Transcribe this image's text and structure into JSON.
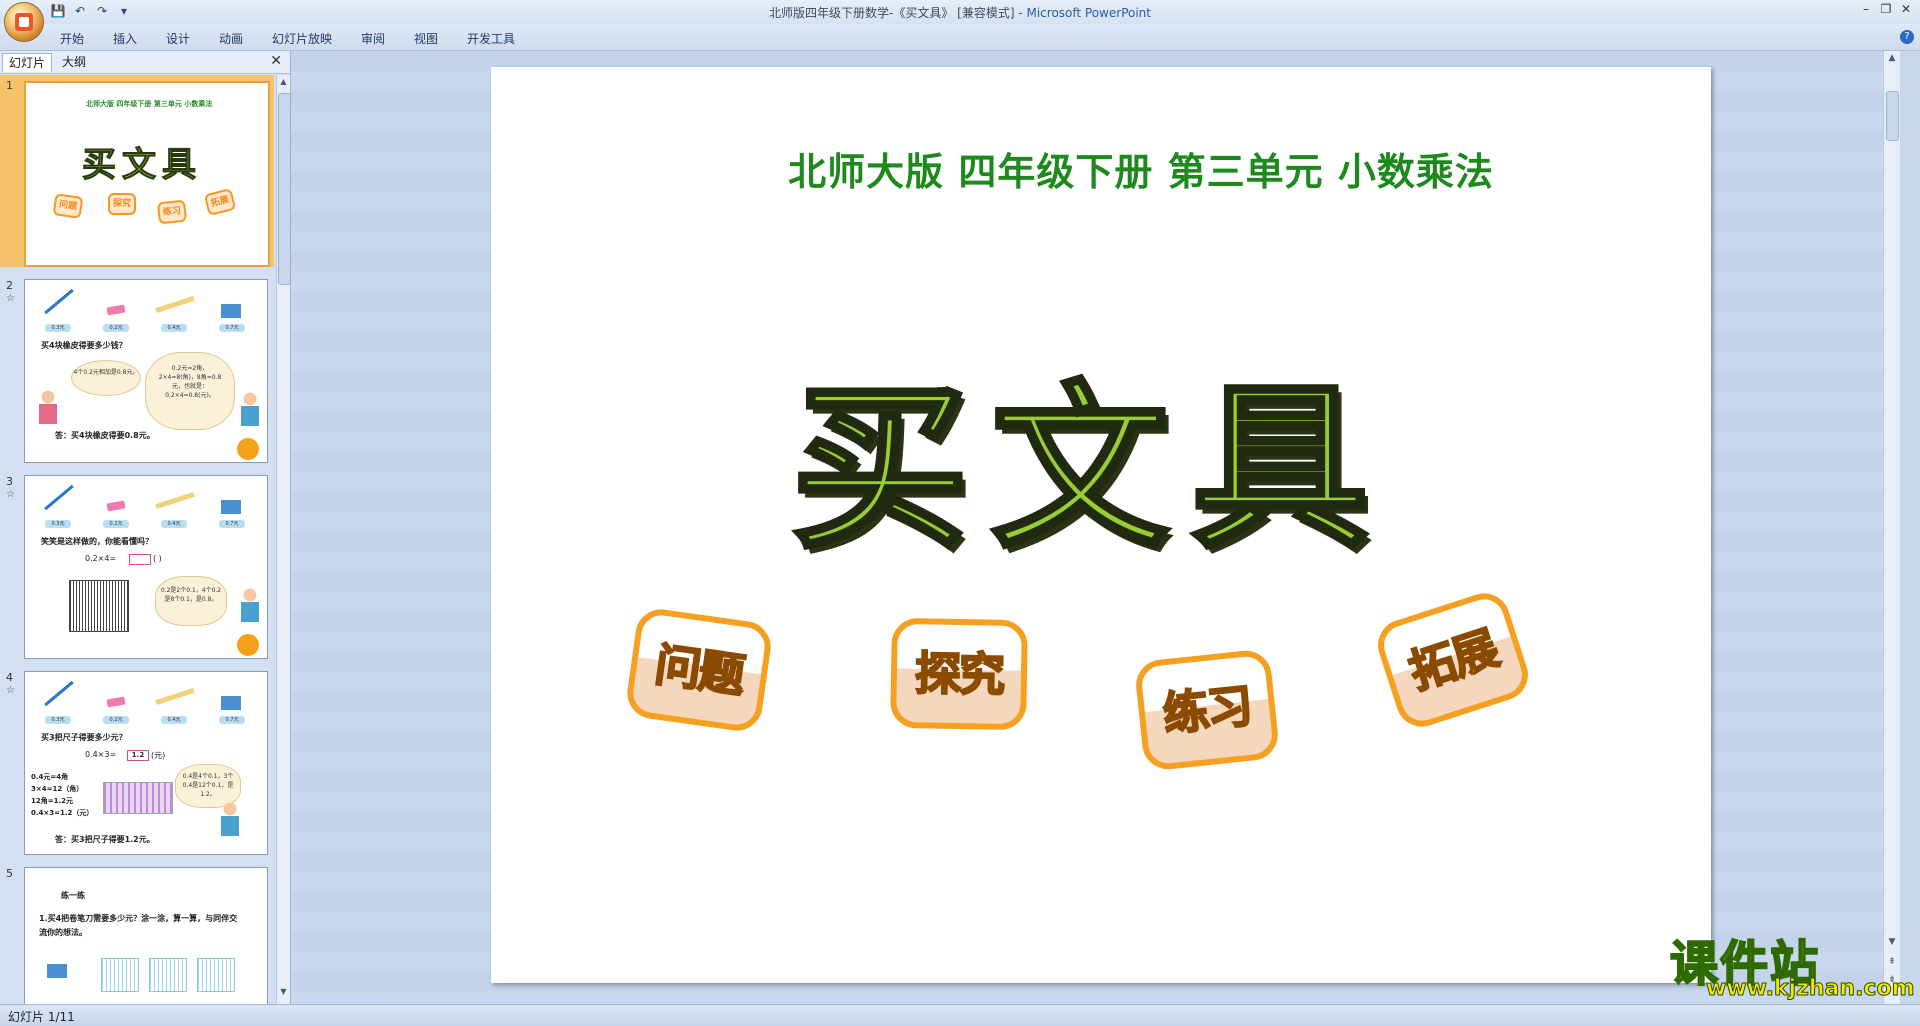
{
  "window": {
    "title": "北师版四年级下册数学-《买文具》 [兼容模式] - ",
    "app_name": "Microsoft PowerPoint",
    "controls": [
      "–",
      "❐",
      "✕"
    ]
  },
  "quick_access": [
    "💾",
    "↶",
    "↷",
    "▾"
  ],
  "ribbon": {
    "tabs": [
      "开始",
      "插入",
      "设计",
      "动画",
      "幻灯片放映",
      "审阅",
      "视图",
      "开发工具"
    ],
    "help": "?"
  },
  "left_pane": {
    "tabs": [
      "幻灯片",
      "大纲"
    ],
    "close": "✕",
    "thumbnails": [
      {
        "number": "1",
        "subtitle": "北师大版  四年级下册  第三单元  小数乘法",
        "title": "买文具",
        "badges": [
          "问题",
          "探究",
          "练习",
          "拓展"
        ]
      },
      {
        "number": "2",
        "prices": [
          "0.3元",
          "0.2元",
          "0.4元",
          "0.7元"
        ],
        "question": "买4块橡皮得要多少钱？",
        "bubble_left": "4个0.2元相加是0.8元。",
        "bubble_right": "0.2元=2角，2×4=8(角)，8角=0.8元，也就是：0.2×4=0.8(元)。",
        "answer": "答：买4块橡皮得要0.8元。"
      },
      {
        "number": "3",
        "prices": [
          "0.3元",
          "0.2元",
          "0.4元",
          "0.7元"
        ],
        "question": "笑笑是这样做的，你能看懂吗？",
        "formula": "0.2×4=",
        "unit": "(  )",
        "bubble_right": "0.2是2个0.1，4个0.2是8个0.1，是0.8。"
      },
      {
        "number": "4",
        "prices": [
          "0.3元",
          "0.2元",
          "0.4元",
          "0.7元"
        ],
        "question": "买3把尺子得要多少元？",
        "formula": "0.4×3=",
        "box": "1.2",
        "unit": "(元)",
        "steps": [
          "0.4元=4角",
          "3×4=12（角）",
          "12角=1.2元",
          "0.4×3=1.2（元）"
        ],
        "bubble_right": "0.4是4个0.1，3个0.4是12个0.1，是1.2。",
        "answer": "答：买3把尺子得要1.2元。"
      },
      {
        "number": "5",
        "heading": "练一练",
        "question": "1.买4把卷笔刀需要多少元？涂一涂，算一算，与同伴交流你的想法。"
      }
    ]
  },
  "slide": {
    "subtitle": "北师大版  四年级下册  第三单元  小数乘法",
    "title": "买文具",
    "badges": [
      "问题",
      "探究",
      "练习",
      "拓展"
    ]
  },
  "watermark": {
    "main": "课件站",
    "sub": "www.kjzhan.com"
  },
  "status": {
    "text": "幻灯片 1/11"
  },
  "colors": {
    "title_green": "#9acd32",
    "subtitle_green": "#1e8a1e",
    "badge_orange": "#f5a020"
  }
}
